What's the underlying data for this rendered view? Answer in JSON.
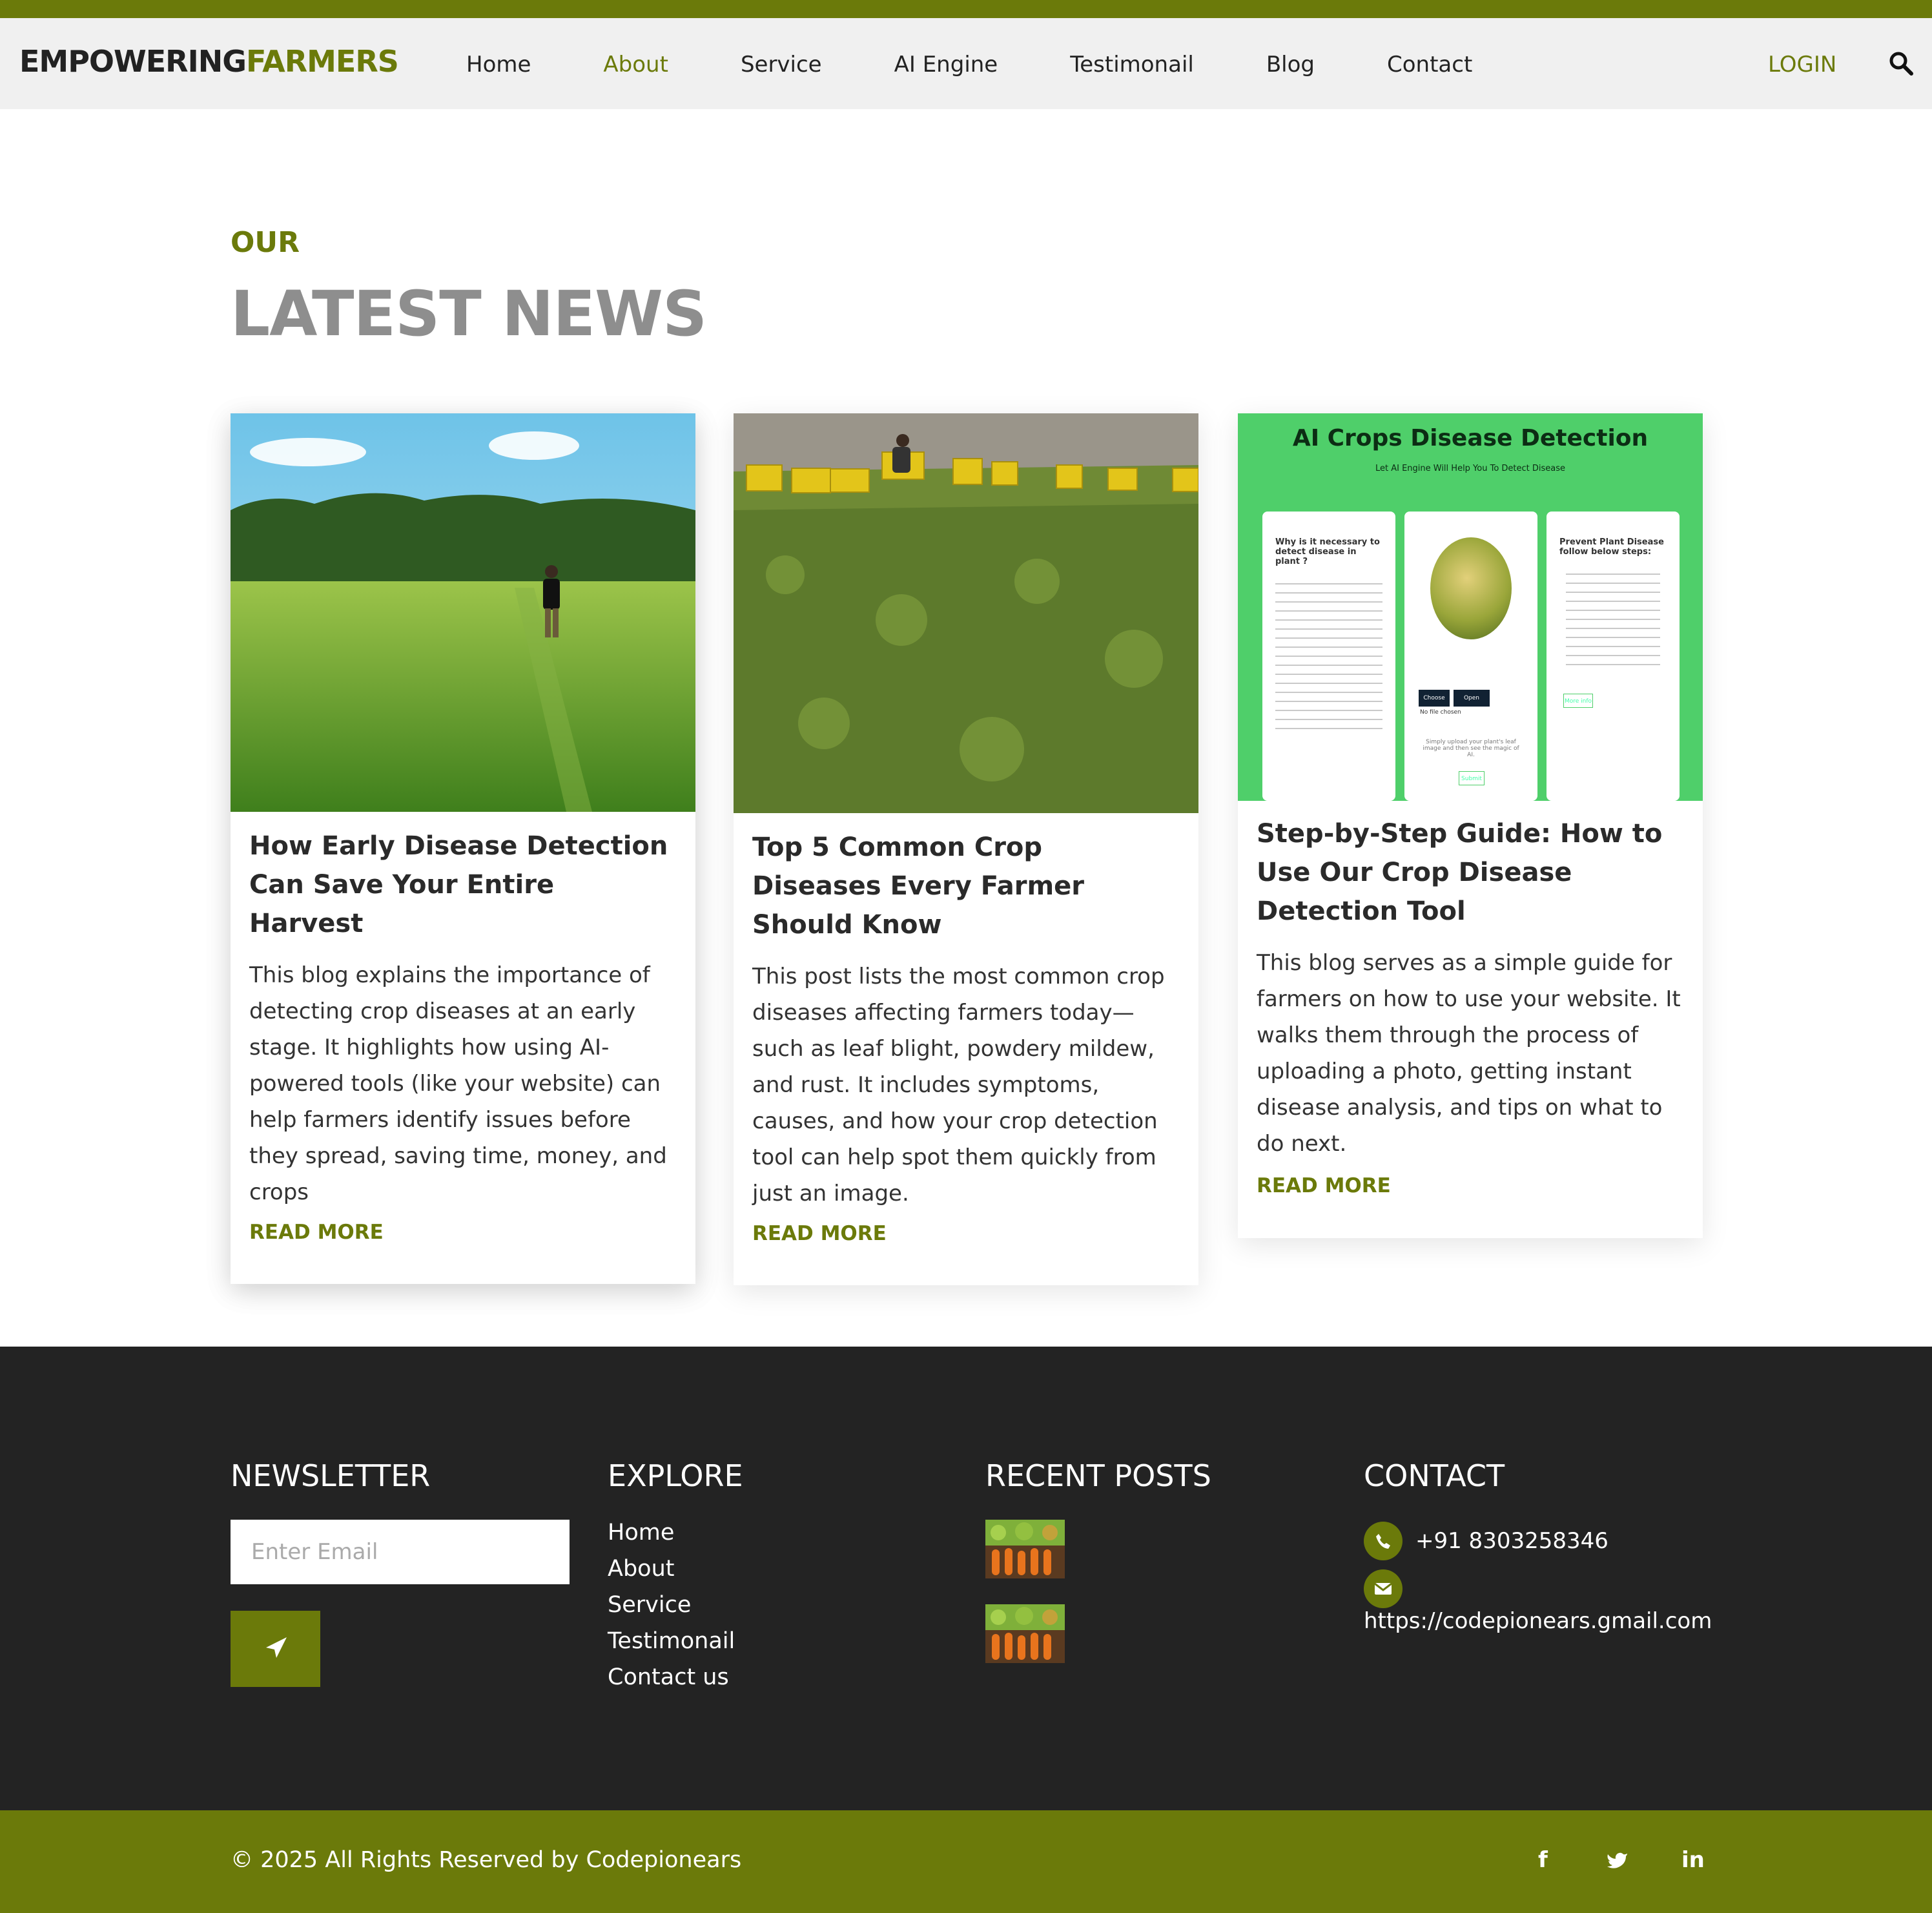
{
  "brand": {
    "part1": "EMPOWERING",
    "part2": "FARMERS",
    "accent": "#6b7a0a",
    "dark": "#232323"
  },
  "nav": {
    "items": [
      "Home",
      "About",
      "Service",
      "AI Engine",
      "Testimonail",
      "Blog",
      "Contact"
    ],
    "active": "About",
    "login": "LOGIN",
    "search_icon": "search-icon"
  },
  "news": {
    "kicker": "OUR",
    "title": "LATEST NEWS",
    "cards": [
      {
        "title": "How Early Disease Detection Can Save Your Entire Harvest",
        "body": "This blog explains the importance of detecting crop diseases at an early stage. It highlights how using AI-powered tools (like your website) can help farmers identify issues before they spread, saving time, money, and crops",
        "more": "READ MORE"
      },
      {
        "title": "Top 5 Common Crop Diseases Every Farmer Should Know",
        "body": "This post lists the most common crop diseases affecting farmers today—such as leaf blight, powdery mildew, and rust. It includes symptoms, causes, and how your crop detection tool can help spot them quickly from just an image.",
        "more": "READ MORE"
      },
      {
        "title": "Step-by-Step Guide: How to Use Our Crop Disease Detection Tool",
        "body": "This blog serves as a simple guide for farmers on how to use your website. It walks them through the process of uploading a photo, getting instant disease analysis, and tips on what to do next.",
        "more": "READ MORE",
        "screenshot": {
          "heading": "AI Crops Disease Detection",
          "subheading": "Let AI Engine Will Help You To Detect Disease",
          "left_title": "Why is it necessary to detect disease in plant ?",
          "right_title": "Prevent Plant Disease follow below steps:",
          "btn1": "Choose File",
          "btn2": "Open Camera",
          "no_file": "No file chosen",
          "upload_hint": "Simply upload your plant's leaf image and then see the magic of AI.",
          "submit": "Submit",
          "more_info": "More info"
        }
      }
    ]
  },
  "footer": {
    "newsletter": {
      "title": "NEWSLETTER",
      "placeholder": "Enter Email"
    },
    "explore": {
      "title": "EXPLORE",
      "links": [
        "Home",
        "About",
        "Service",
        "Testimonail",
        "Contact us"
      ]
    },
    "recent": {
      "title": "RECENT POSTS"
    },
    "contact": {
      "title": "CONTACT",
      "phone": "+91 8303258346",
      "email": "https://codepionears.gmail.com"
    },
    "copyright": "© 2025 All Rights Reserved by Codepionears",
    "social": [
      "f",
      "twitter-icon",
      "in"
    ]
  }
}
